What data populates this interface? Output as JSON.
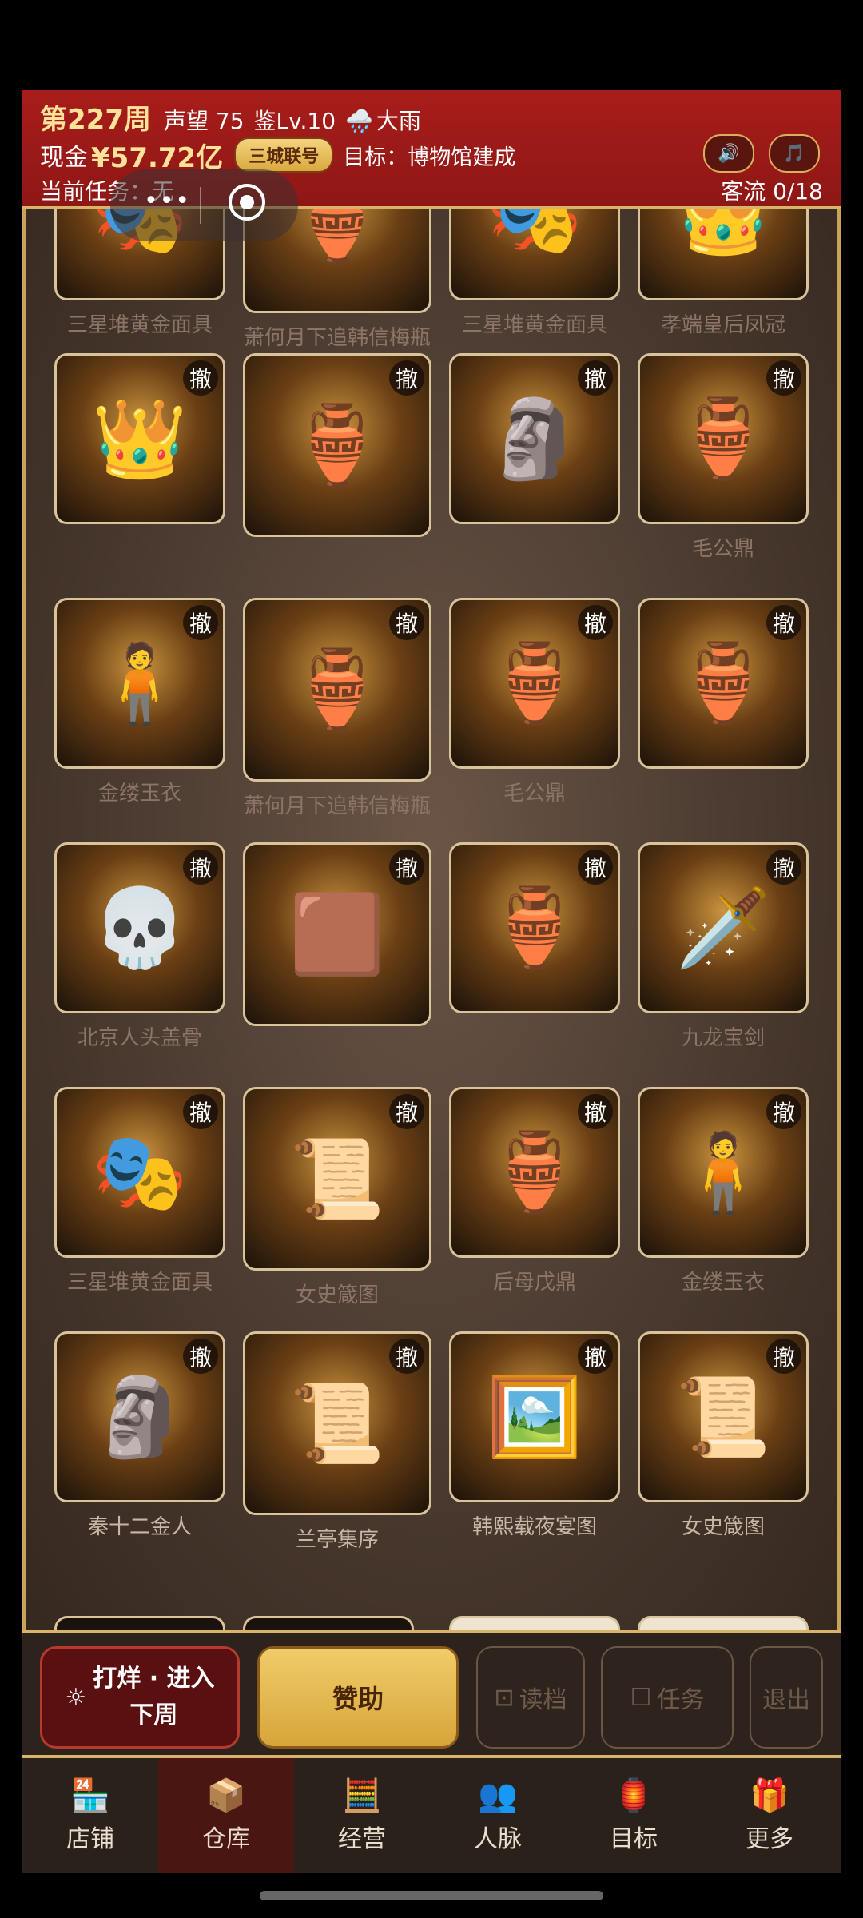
{
  "header": {
    "week": "第227周",
    "reputation": "声望 75",
    "appraisal": "鉴Lv.10",
    "weather_icon": "🌧️",
    "weather": "大雨",
    "cash_label": "现金",
    "cash": "¥57.72亿",
    "badge": "三城联号",
    "target": "目标：博物馆建成",
    "task": "当前任务：无",
    "traffic": "客流 0/18",
    "sound_icon": "🔊",
    "music_icon": "🎵"
  },
  "overlay": {
    "dots": "•••"
  },
  "undo_label": "撤",
  "grid": [
    {
      "name": "三星堆黄金面具",
      "icon": "🎭",
      "bright": false,
      "undo": false
    },
    {
      "name": "萧何月下追韩信梅瓶",
      "icon": "🏺",
      "bright": false,
      "undo": false
    },
    {
      "name": "三星堆黄金面具",
      "icon": "🎭",
      "bright": false,
      "undo": false
    },
    {
      "name": "孝端皇后凤冠",
      "icon": "👑",
      "bright": false,
      "undo": false
    },
    {
      "name": "",
      "icon": "👑",
      "bright": false,
      "undo": true
    },
    {
      "name": "",
      "icon": "🏺",
      "bright": false,
      "undo": true
    },
    {
      "name": "",
      "icon": "🗿",
      "bright": false,
      "undo": true
    },
    {
      "name": "毛公鼎",
      "icon": "🏺",
      "bright": false,
      "undo": true
    },
    {
      "name": "金缕玉衣",
      "icon": "🧍",
      "bright": false,
      "undo": true
    },
    {
      "name": "萧何月下追韩信梅瓶",
      "icon": "🏺",
      "bright": false,
      "undo": true
    },
    {
      "name": "毛公鼎",
      "icon": "🏺",
      "bright": false,
      "undo": true
    },
    {
      "name": "",
      "icon": "🏺",
      "bright": false,
      "undo": true
    },
    {
      "name": "北京人头盖骨",
      "icon": "💀",
      "bright": false,
      "undo": true
    },
    {
      "name": "",
      "icon": "🟫",
      "bright": false,
      "undo": true
    },
    {
      "name": "",
      "icon": "🏺",
      "bright": false,
      "undo": true
    },
    {
      "name": "九龙宝剑",
      "icon": "🗡️",
      "bright": false,
      "undo": true
    },
    {
      "name": "三星堆黄金面具",
      "icon": "🎭",
      "bright": false,
      "undo": true
    },
    {
      "name": "女史箴图",
      "icon": "📜",
      "bright": false,
      "undo": true
    },
    {
      "name": "后母戊鼎",
      "icon": "🏺",
      "bright": false,
      "undo": true
    },
    {
      "name": "金缕玉衣",
      "icon": "🧍",
      "bright": false,
      "undo": true
    },
    {
      "name": "秦十二金人",
      "icon": "🗿",
      "bright": true,
      "undo": true
    },
    {
      "name": "兰亭集序",
      "icon": "📜",
      "bright": true,
      "undo": true
    },
    {
      "name": "韩熙载夜宴图",
      "icon": "🖼️",
      "bright": true,
      "undo": true
    },
    {
      "name": "女史箴图",
      "icon": "📜",
      "bright": true,
      "undo": true
    }
  ],
  "actions": {
    "next_icon": "☼",
    "next_line1": "打烊 · 进入",
    "next_line2": "下周",
    "sponsor": "赞助",
    "load_icon": "⊡",
    "load": "读档",
    "task_icon": "☐",
    "task": "任务",
    "exit": "退出"
  },
  "tabs": [
    {
      "label": "店铺",
      "icon": "🏪"
    },
    {
      "label": "仓库",
      "icon": "📦"
    },
    {
      "label": "经营",
      "icon": "🧮"
    },
    {
      "label": "人脉",
      "icon": "👥"
    },
    {
      "label": "目标",
      "icon": "🏮"
    },
    {
      "label": "更多",
      "icon": "🎁"
    }
  ]
}
